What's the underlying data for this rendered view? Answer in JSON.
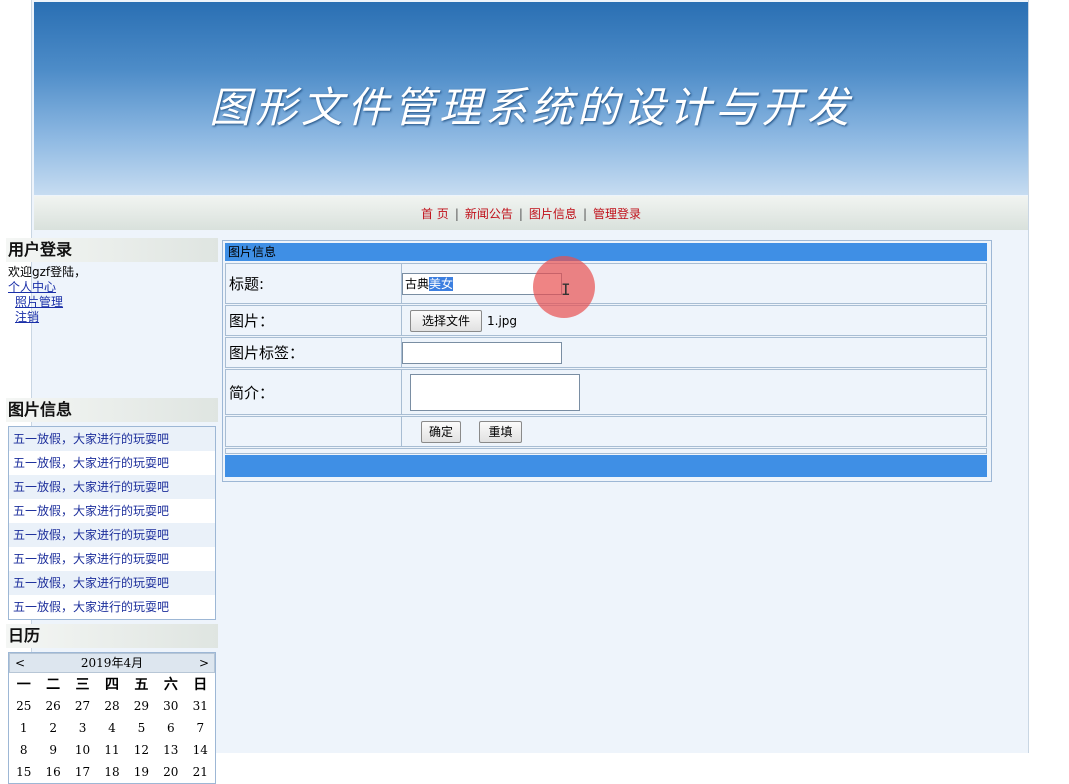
{
  "banner": {
    "title": "图形文件管理系统的设计与开发"
  },
  "nav": {
    "items": [
      "首 页",
      "新闻公告",
      "图片信息",
      "管理登录"
    ]
  },
  "sidebar": {
    "login": {
      "title": "用户登录",
      "welcome": "欢迎gzf登陆，",
      "user_center": "个人中心",
      "photo_manage": "照片管理",
      "logout": "注销"
    },
    "pic_info": {
      "title": "图片信息",
      "items": [
        "五一放假，大家进行的玩耍吧",
        "五一放假，大家进行的玩耍吧",
        "五一放假，大家进行的玩耍吧",
        "五一放假，大家进行的玩耍吧",
        "五一放假，大家进行的玩耍吧",
        "五一放假，大家进行的玩耍吧",
        "五一放假，大家进行的玩耍吧",
        "五一放假，大家进行的玩耍吧"
      ]
    },
    "calendar": {
      "title": "日历",
      "prev": "<",
      "next": ">",
      "month": "2019年4月",
      "weekdays": [
        "一",
        "二",
        "三",
        "四",
        "五",
        "六",
        "日"
      ],
      "weeks": [
        [
          "25",
          "26",
          "27",
          "28",
          "29",
          "30",
          "31"
        ],
        [
          "1",
          "2",
          "3",
          "4",
          "5",
          "6",
          "7"
        ],
        [
          "8",
          "9",
          "10",
          "11",
          "12",
          "13",
          "14"
        ],
        [
          "15",
          "16",
          "17",
          "18",
          "19",
          "20",
          "21"
        ]
      ]
    }
  },
  "form": {
    "header": "图片信息",
    "title_label": "标题:",
    "title_value_plain": "古典",
    "title_value_selected": "美女",
    "image_label": "图片：",
    "choose_file": "选择文件",
    "file_name": "1.jpg",
    "tag_label": "图片标签：",
    "tag_value": "",
    "intro_label": "简介：",
    "intro_value": "",
    "confirm": "确定",
    "reset": "重填"
  },
  "colors": {
    "accent": "#3f8fe5",
    "nav_link": "#c0101a",
    "link": "#1d2f9c"
  }
}
